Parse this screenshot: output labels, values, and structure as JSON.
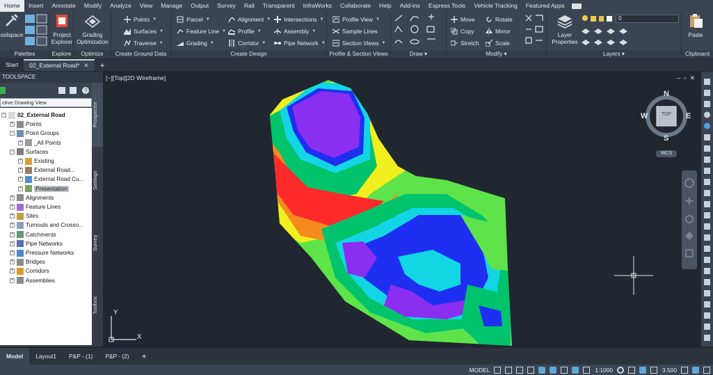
{
  "colors": {
    "accent": "#5fa9d6",
    "ribbon_bg": "#3b4453",
    "viewport_bg": "#212730",
    "tree_bg": "#ffffff"
  },
  "menu": {
    "items": [
      "Home",
      "Insert",
      "Annotate",
      "Modify",
      "Analyze",
      "View",
      "Manage",
      "Output",
      "Survey",
      "Rail",
      "Transparent",
      "InfraWorks",
      "Collaborate",
      "Help",
      "Add-ins",
      "Express Tools",
      "Vehicle Tracking",
      "Featured Apps"
    ],
    "active": "Home"
  },
  "ribbon": {
    "palettes": {
      "big_label": "oolspace",
      "title": "Palettes"
    },
    "explore": {
      "big_label_1": "Project",
      "big_label_2": "Explorer",
      "title": "Explore"
    },
    "optimize": {
      "big_label_1": "Grading",
      "big_label_2": "Optimization",
      "title": "Optimize"
    },
    "ground": {
      "points": "Points",
      "surfaces": "Surfaces",
      "traverse": "Traverse",
      "title": "Create Ground Data"
    },
    "design": {
      "parcel": "Parcel",
      "feature_line": "Feature Line",
      "grading": "Grading",
      "alignment": "Alignment",
      "profile": "Profile",
      "corridor": "Corridor",
      "intersections": "Intersections",
      "assembly": "Assembly",
      "pipe_network": "Pipe Network",
      "title": "Create Design"
    },
    "views": {
      "profile_view": "Profile View",
      "sample_lines": "Sample Lines",
      "section_views": "Section Views",
      "title": "Profile & Section Views"
    },
    "draw": {
      "title": "Draw"
    },
    "modify": {
      "move": "Move",
      "copy": "Copy",
      "stretch": "Stretch",
      "rotate": "Rotate",
      "mirror": "Mirror",
      "scale": "Scale",
      "title": "Modify"
    },
    "layers": {
      "big_label_1": "Layer",
      "big_label_2": "Properties",
      "current_layer": "0",
      "title": "Layers"
    },
    "clipboard": {
      "paste": "Paste",
      "title": "Clipboard"
    }
  },
  "doc_tabs": {
    "start": "Start",
    "active": "02_External Road*"
  },
  "toolspace": {
    "title": "TOOLSPACE",
    "view_combo": "ctive Drawing View",
    "tabs": [
      "Prospector",
      "Settings",
      "Survey",
      "Toolbox"
    ],
    "tree": [
      {
        "label": "02_External Road",
        "level": 0
      },
      {
        "label": "Points",
        "level": 1
      },
      {
        "label": "Point Groups",
        "level": 1
      },
      {
        "label": "_All Points",
        "level": 2
      },
      {
        "label": "Surfaces",
        "level": 1
      },
      {
        "label": "Existing",
        "level": 2
      },
      {
        "label": "External Road...",
        "level": 2
      },
      {
        "label": "External Road Cu...",
        "level": 2
      },
      {
        "label": "Presentation",
        "level": 2
      },
      {
        "label": "Alignments",
        "level": 1
      },
      {
        "label": "Feature Lines",
        "level": 1
      },
      {
        "label": "Sites",
        "level": 1
      },
      {
        "label": "Turnouts and Crosso...",
        "level": 1
      },
      {
        "label": "Catchments",
        "level": 1
      },
      {
        "label": "Pipe Networks",
        "level": 1
      },
      {
        "label": "Pressure Networks",
        "level": 1
      },
      {
        "label": "Bridges",
        "level": 1
      },
      {
        "label": "Corridors",
        "level": 1
      },
      {
        "label": "Assemblies",
        "level": 1
      }
    ]
  },
  "viewport": {
    "label": "[−][Top][2D Wireframe]",
    "window_buttons": "–▫✕",
    "viewcube": {
      "face": "TOP",
      "north": "N",
      "south": "S",
      "east": "E",
      "west": "W",
      "ucs": "WCS"
    },
    "ucs_axes": {
      "x": "X",
      "y": "Y"
    }
  },
  "layout_tabs": [
    "Model",
    "Layout1",
    "P&P - (1)",
    "P&P - (2)"
  ],
  "status": {
    "model": "MODEL",
    "scale": "1:1000",
    "value": "3.500"
  }
}
